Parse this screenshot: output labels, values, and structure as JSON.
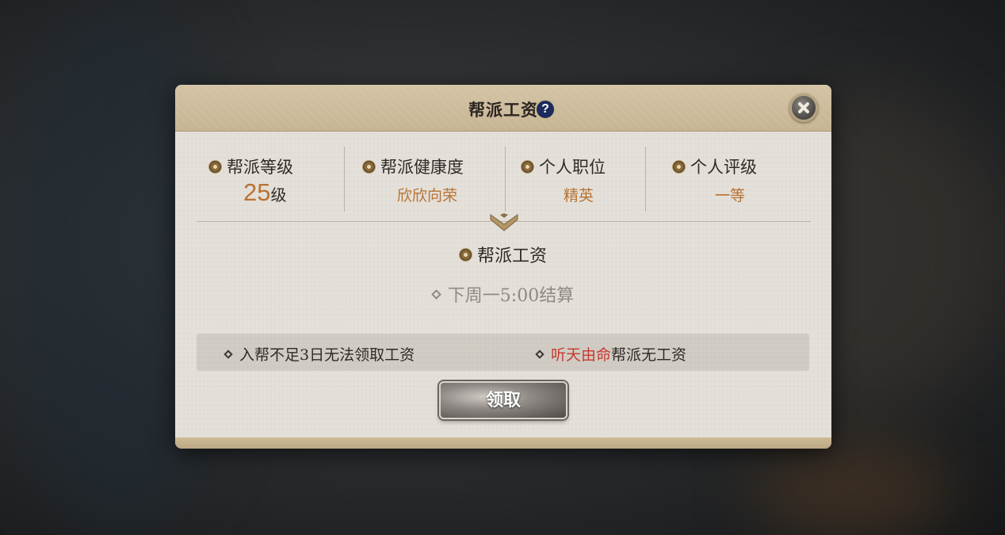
{
  "dialog": {
    "title": "帮派工资",
    "help_icon_glyph": "?",
    "stats": [
      {
        "label": "帮派等级",
        "value_number": "25",
        "value_unit": "级"
      },
      {
        "label": "帮派健康度",
        "value": "欣欣向荣"
      },
      {
        "label": "个人职位",
        "value": "精英"
      },
      {
        "label": "个人评级",
        "value": "一等"
      }
    ],
    "salary_title": "帮派工资",
    "settle_text": "下周一5:00结算",
    "notices": {
      "left": "入帮不足3日无法领取工资",
      "right_highlight": "听天由命",
      "right_rest": "帮派无工资"
    },
    "claim_button": "领取"
  },
  "colors": {
    "accent_value": "#b87333",
    "highlight_red": "#c8392e",
    "header": "#c6b493",
    "panel": "#e5e1da"
  }
}
